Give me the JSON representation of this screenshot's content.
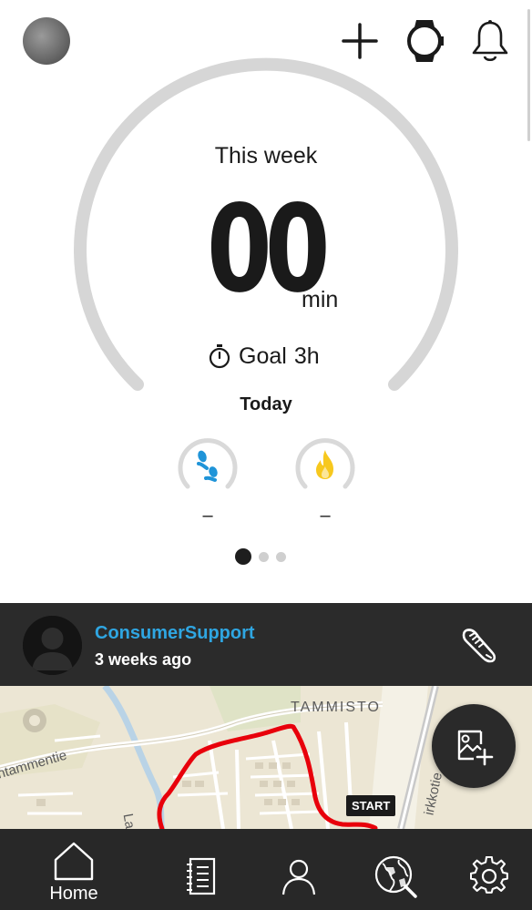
{
  "dashboard": {
    "period_label": "This week",
    "duration_value": "00",
    "duration_unit": "min",
    "goal_label": "Goal",
    "goal_value": "3h",
    "today_label": "Today",
    "steps_value": "–",
    "calories_value": "–",
    "page_count": 3,
    "active_page": 1
  },
  "feed": {
    "user_name": "ConsumerSupport",
    "time_ago": "3 weeks ago",
    "map": {
      "place_tammisto": "TAMMISTO",
      "street_left": "ntammentie",
      "street_right": "irkkotie",
      "street_bottom": "La",
      "start_label": "START"
    }
  },
  "nav": {
    "items": [
      {
        "label": "Home",
        "icon": "home-icon",
        "active": true
      },
      {
        "label": "",
        "icon": "diary-icon"
      },
      {
        "label": "",
        "icon": "person-icon"
      },
      {
        "label": "",
        "icon": "globe-search-icon"
      },
      {
        "label": "",
        "icon": "gear-icon"
      }
    ]
  },
  "colors": {
    "accent_blue": "#2fa6e2",
    "arc_gray": "#d6d6d6",
    "route_red": "#e8000b",
    "flame_yellow": "#f7c81e",
    "steps_blue": "#1f94d8",
    "dark_bar": "#2b2b2b"
  }
}
